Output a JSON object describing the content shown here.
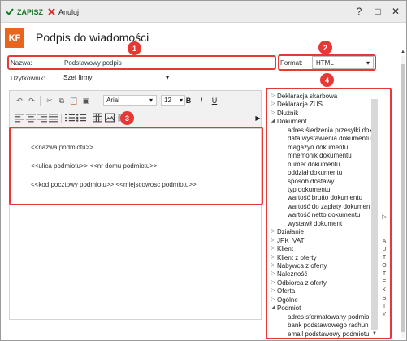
{
  "topbar": {
    "save_label": "ZAPISZ",
    "cancel_label": "Anuluj",
    "help": "?",
    "maximize": "□",
    "close": "✕"
  },
  "header": {
    "logo": "KF",
    "title": "Podpis do wiadomości"
  },
  "form": {
    "name_label": "Nazwa:",
    "name_value": "Podstawowy podpis",
    "format_label": "Format:",
    "format_value": "HTML",
    "user_label": "Użytkownik:",
    "user_value": "Szef firmy"
  },
  "toolbar": {
    "font": "Arial",
    "size": "12",
    "bold": "B",
    "italic": "I",
    "underline": "U"
  },
  "editor": {
    "lines": [
      "<<nazwa podmiotu>>",
      "<<ulica podmiotu>> <<nr domu podmiotu>>",
      "<<kod pocztowy podmiotu>> <<miejscowosc podmiotu>>"
    ]
  },
  "callouts": [
    "1",
    "2",
    "3",
    "4"
  ],
  "tree": {
    "items": [
      {
        "label": "Deklaracja skarbowa",
        "level": 0,
        "state": "collapsed"
      },
      {
        "label": "Deklaracje ZUS",
        "level": 0,
        "state": "collapsed"
      },
      {
        "label": "Dłużnik",
        "level": 0,
        "state": "collapsed"
      },
      {
        "label": "Dokument",
        "level": 0,
        "state": "expanded"
      },
      {
        "label": "adres śledzenia przesyłki dok",
        "level": 1,
        "state": "leaf"
      },
      {
        "label": "data wystawienia dokumentu",
        "level": 1,
        "state": "leaf"
      },
      {
        "label": "magazyn dokumentu",
        "level": 1,
        "state": "leaf"
      },
      {
        "label": "mnemonik dokumentu",
        "level": 1,
        "state": "leaf"
      },
      {
        "label": "numer dokumentu",
        "level": 1,
        "state": "leaf"
      },
      {
        "label": "oddział dokumentu",
        "level": 1,
        "state": "leaf"
      },
      {
        "label": "sposób dostawy",
        "level": 1,
        "state": "leaf"
      },
      {
        "label": "typ dokumentu",
        "level": 1,
        "state": "leaf"
      },
      {
        "label": "wartość brutto dokumentu",
        "level": 1,
        "state": "leaf"
      },
      {
        "label": "wartość do zapłaty dokumen",
        "level": 1,
        "state": "leaf"
      },
      {
        "label": "wartość netto dokumentu",
        "level": 1,
        "state": "leaf"
      },
      {
        "label": "wystawił dokument",
        "level": 1,
        "state": "leaf"
      },
      {
        "label": "Działanie",
        "level": 0,
        "state": "collapsed"
      },
      {
        "label": "JPK_VAT",
        "level": 0,
        "state": "collapsed"
      },
      {
        "label": "Klient",
        "level": 0,
        "state": "collapsed"
      },
      {
        "label": "Klient z oferty",
        "level": 0,
        "state": "collapsed"
      },
      {
        "label": "Nabywca z oferty",
        "level": 0,
        "state": "collapsed"
      },
      {
        "label": "Należność",
        "level": 0,
        "state": "collapsed"
      },
      {
        "label": "Odbiorca z oferty",
        "level": 0,
        "state": "collapsed"
      },
      {
        "label": "Oferta",
        "level": 0,
        "state": "collapsed"
      },
      {
        "label": "Ogólne",
        "level": 0,
        "state": "collapsed"
      },
      {
        "label": "Podmiot",
        "level": 0,
        "state": "expanded"
      },
      {
        "label": "adres sformatowany podmio",
        "level": 1,
        "state": "leaf"
      },
      {
        "label": "bank podstawowego rachun",
        "level": 1,
        "state": "leaf"
      },
      {
        "label": "email podstawowy podmiotu",
        "level": 1,
        "state": "leaf"
      }
    ]
  },
  "side_tab": {
    "arrow": "▷",
    "letters": [
      "A",
      "U",
      "T",
      "O",
      "T",
      "E",
      "K",
      "S",
      "T",
      "Y"
    ]
  },
  "colors": {
    "accent_red": "#e53935",
    "logo_orange": "#e8641f",
    "save_green": "#1a7a2a"
  }
}
